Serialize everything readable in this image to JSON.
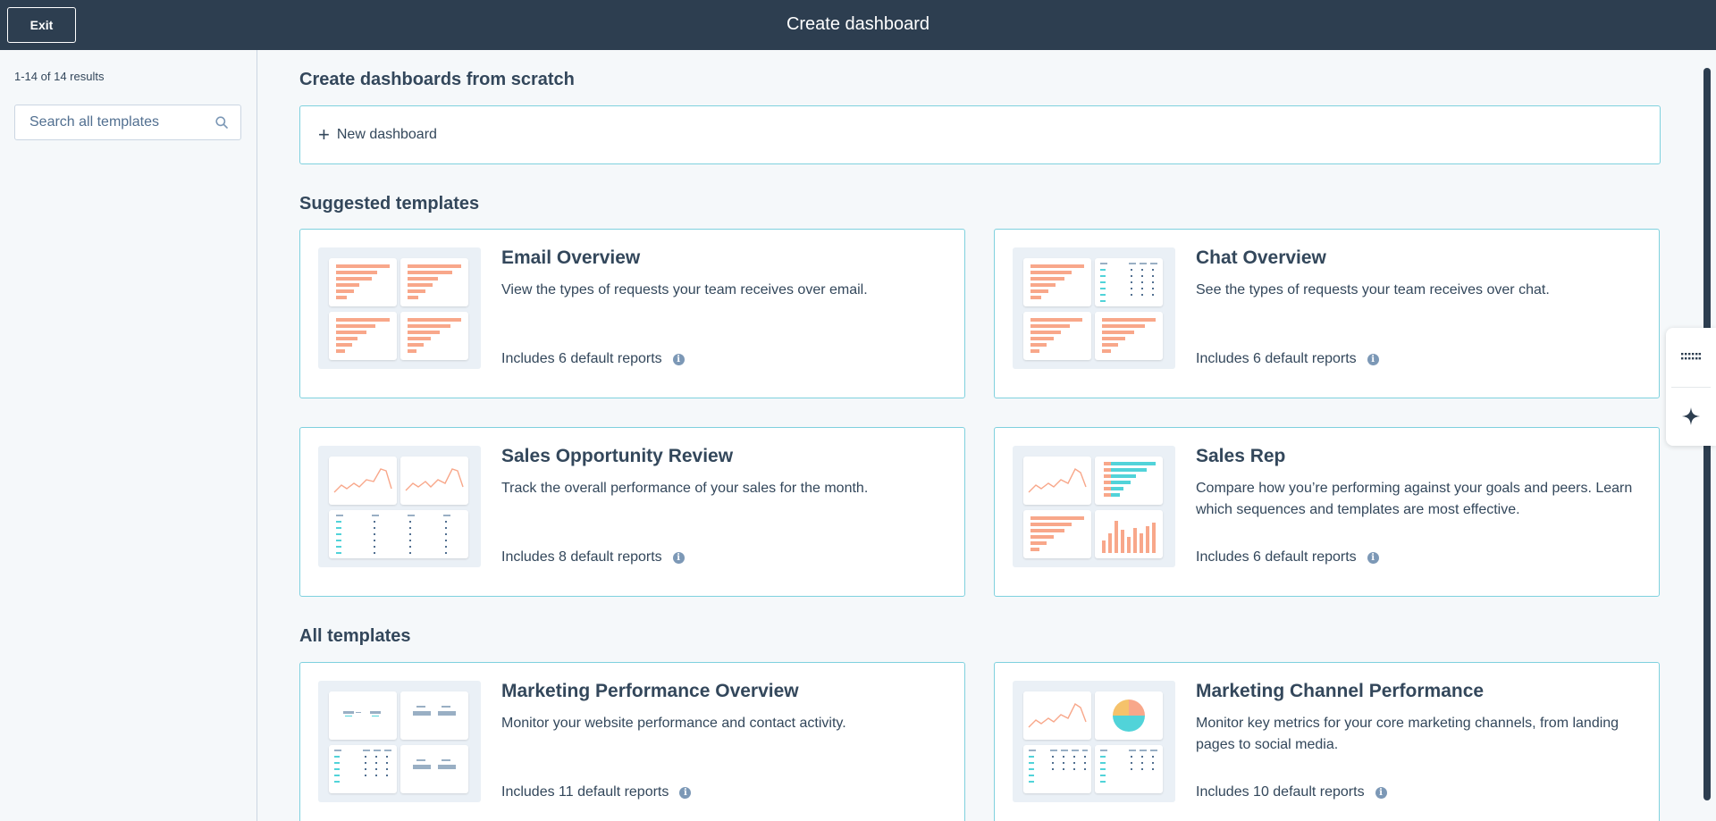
{
  "header": {
    "exit_label": "Exit",
    "title": "Create dashboard"
  },
  "sidebar": {
    "results": "1-14 of 14 results",
    "search_placeholder": "Search all templates"
  },
  "scratch": {
    "title": "Create dashboards from scratch",
    "new_label": "New dashboard"
  },
  "suggested": {
    "title": "Suggested templates",
    "cards": [
      {
        "title": "Email Overview",
        "description": "View the types of requests your team receives over email.",
        "footer": "Includes 6 default reports"
      },
      {
        "title": "Chat Overview",
        "description": "See the types of requests your team receives over chat.",
        "footer": "Includes 6 default reports"
      },
      {
        "title": "Sales Opportunity Review",
        "description": "Track the overall performance of your sales for the month.",
        "footer": "Includes 8 default reports"
      },
      {
        "title": "Sales Rep",
        "description": "Compare how you’re performing against your goals and peers. Learn which sequences and templates are most effective.",
        "footer": "Includes 6 default reports"
      }
    ]
  },
  "all": {
    "title": "All templates",
    "cards": [
      {
        "title": "Marketing Performance Overview",
        "description": "Monitor your website performance and contact activity.",
        "footer": "Includes 11 default reports"
      },
      {
        "title": "Marketing Channel Performance",
        "description": "Monitor key metrics for your core marketing channels, from landing pages to social media.",
        "footer": "Includes 10 default reports"
      }
    ]
  },
  "colors": {
    "header_bg": "#2d3e50",
    "card_border": "#7fd1de",
    "bar_orange": "#f8a78a",
    "bar_teal": "#51d3d9",
    "text": "#33475b"
  },
  "icons": {
    "info": "info-icon",
    "search": "search-icon",
    "plus": "plus-icon",
    "grid_tool": "grid-dots-icon",
    "ai_tool": "sparkle-icon"
  }
}
